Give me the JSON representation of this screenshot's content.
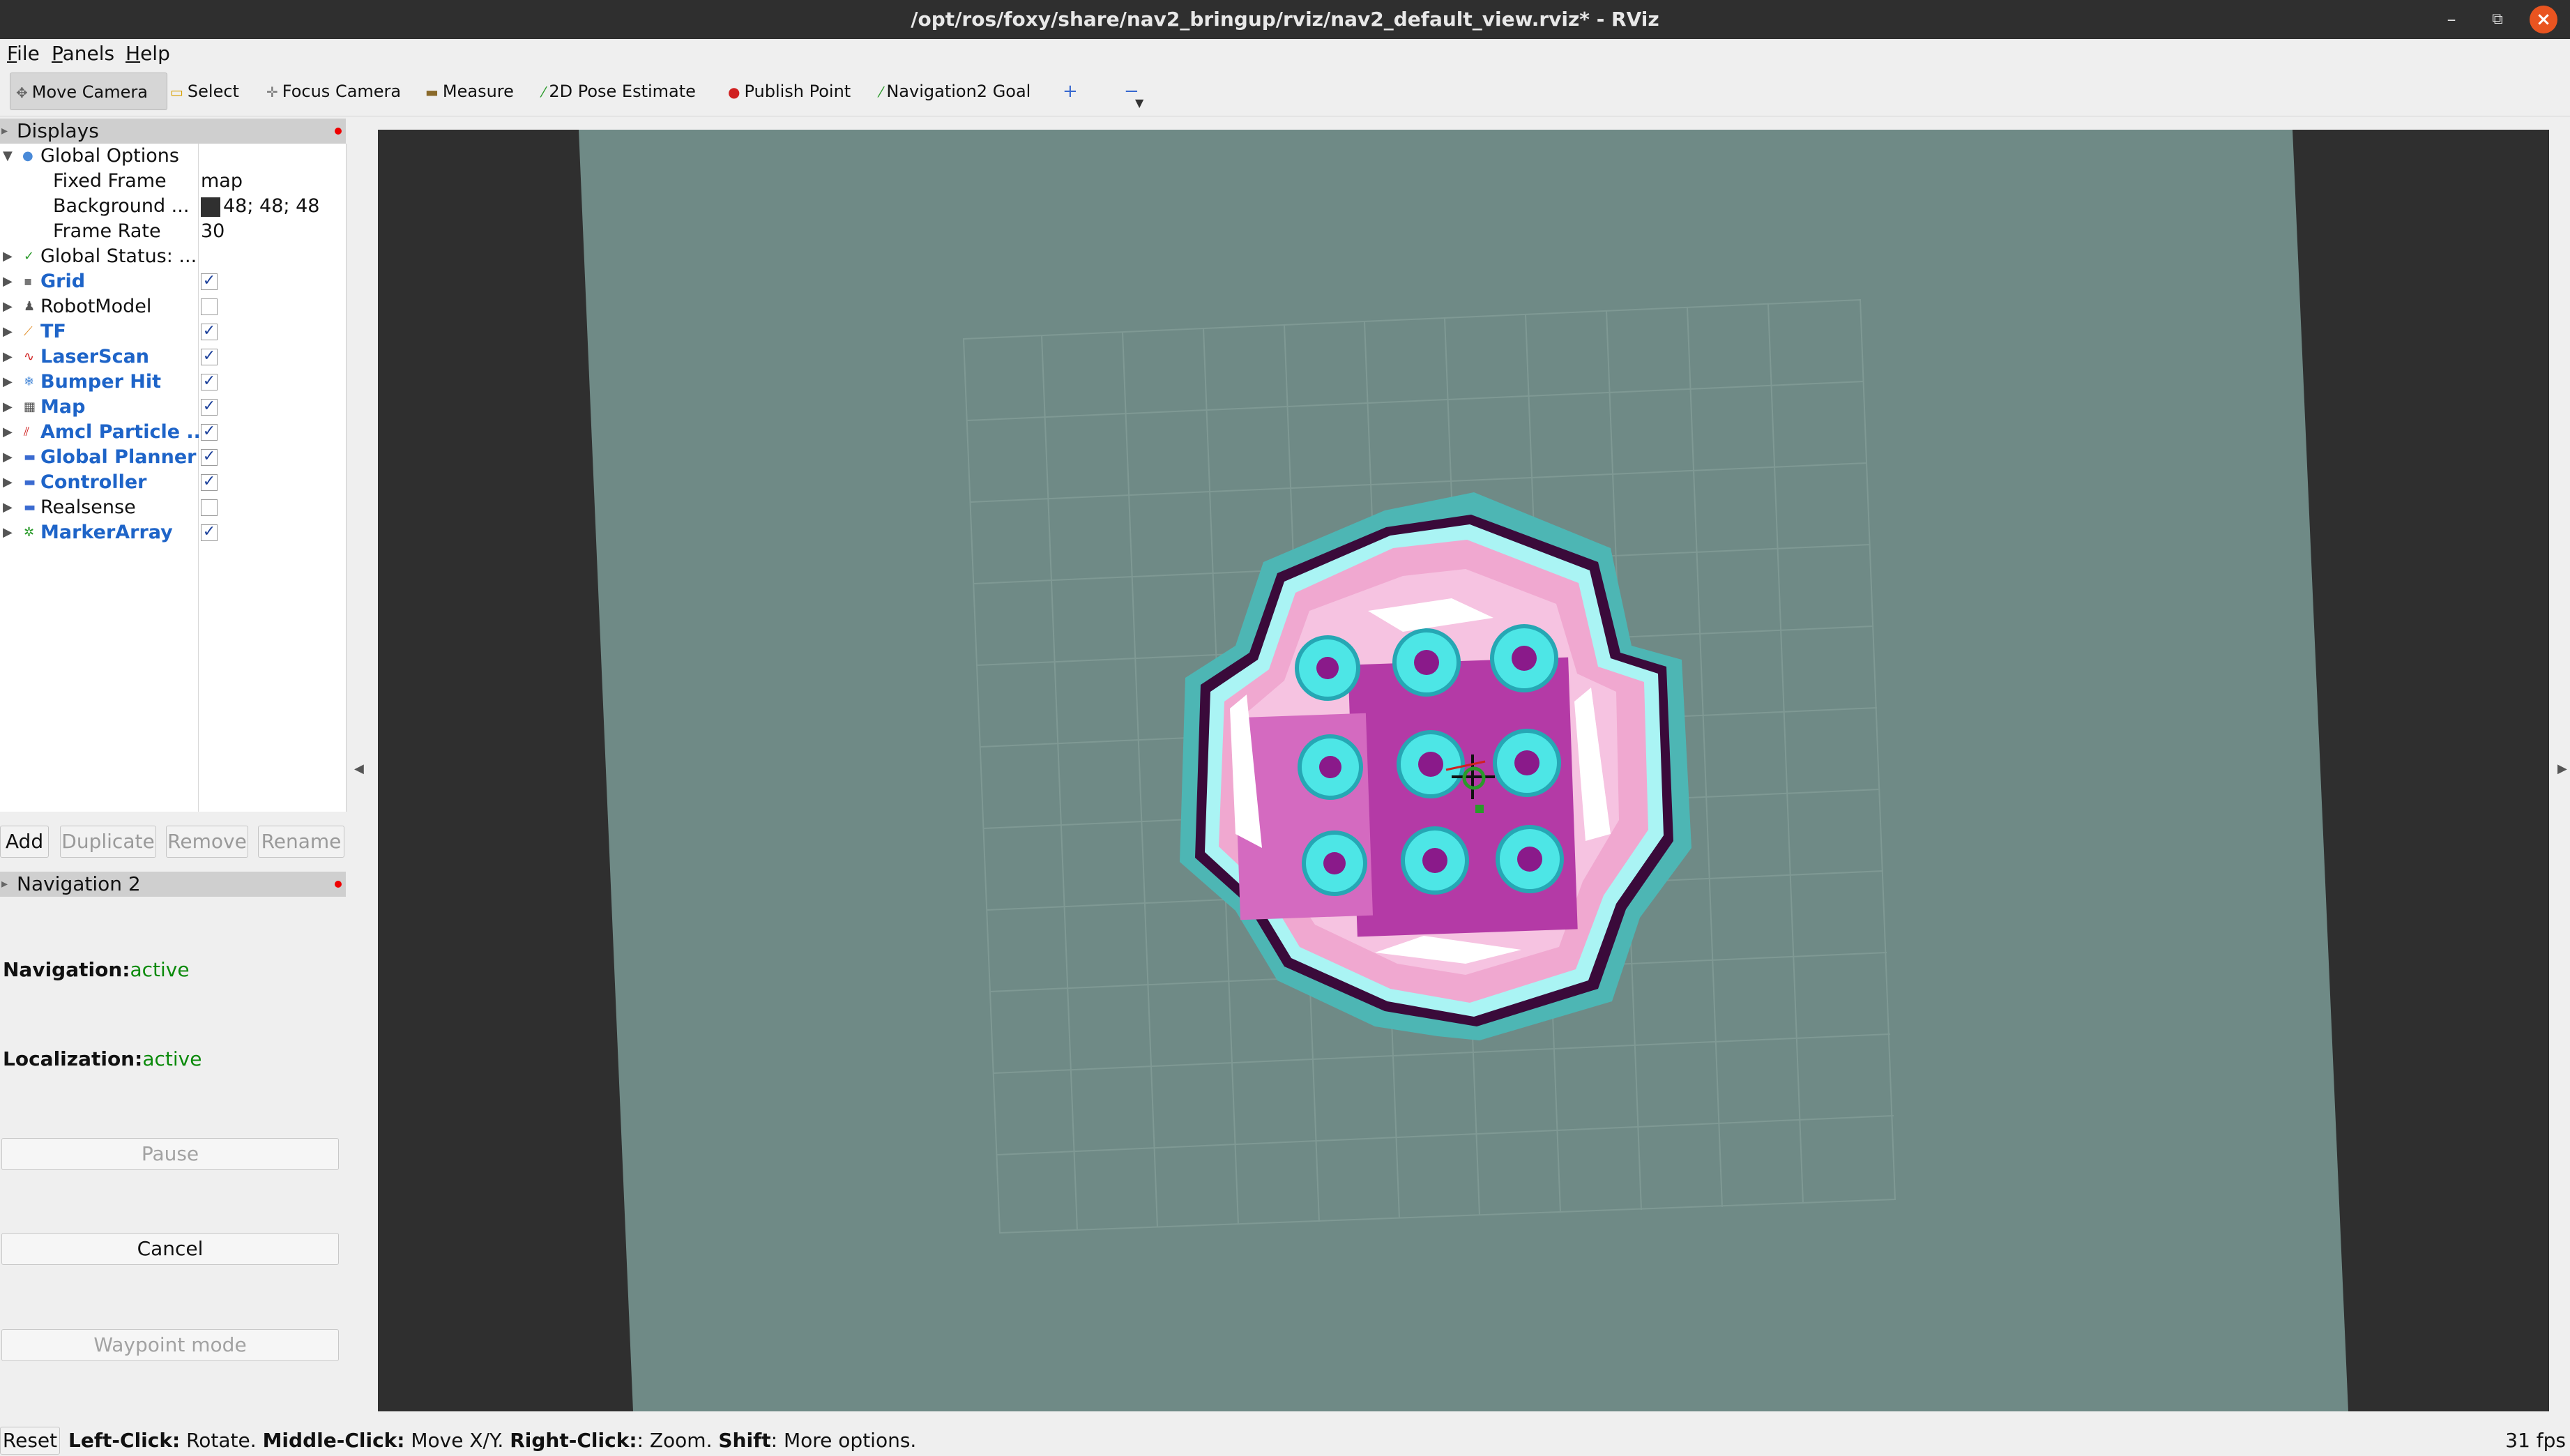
{
  "window": {
    "title": "/opt/ros/foxy/share/nav2_bringup/rviz/nav2_default_view.rviz* - RViz"
  },
  "menu": [
    {
      "key": "F",
      "rest": "ile"
    },
    {
      "key": "P",
      "rest": "anels"
    },
    {
      "key": "H",
      "rest": "elp"
    }
  ],
  "toolbar": {
    "move_camera": "Move Camera",
    "select": "Select",
    "focus_camera": "Focus Camera",
    "measure": "Measure",
    "pose_estimate": "2D Pose Estimate",
    "publish_point": "Publish Point",
    "nav2_goal": "Navigation2 Goal",
    "plus_icon": "+",
    "minus_icon": "−"
  },
  "displays": {
    "title": "Displays",
    "global_options": "Global Options",
    "fixed_frame_label": "Fixed Frame",
    "fixed_frame_value": "map",
    "background_label": "Background ...",
    "background_value": "48; 48; 48",
    "background_color": "#303030",
    "frame_rate_label": "Frame Rate",
    "frame_rate_value": "30",
    "global_status": "Global Status: ...",
    "items": [
      {
        "name": "Grid",
        "checked": true,
        "bold": true
      },
      {
        "name": "RobotModel",
        "checked": false,
        "bold": false
      },
      {
        "name": "TF",
        "checked": true,
        "bold": true
      },
      {
        "name": "LaserScan",
        "checked": true,
        "bold": true
      },
      {
        "name": "Bumper Hit",
        "checked": true,
        "bold": true
      },
      {
        "name": "Map",
        "checked": true,
        "bold": true
      },
      {
        "name": "Amcl Particle ...",
        "checked": true,
        "bold": true
      },
      {
        "name": "Global Planner",
        "checked": true,
        "bold": true
      },
      {
        "name": "Controller",
        "checked": true,
        "bold": true
      },
      {
        "name": "Realsense",
        "checked": false,
        "bold": false
      },
      {
        "name": "MarkerArray",
        "checked": true,
        "bold": true
      }
    ],
    "buttons": {
      "add": "Add",
      "duplicate": "Duplicate",
      "remove": "Remove",
      "rename": "Rename"
    }
  },
  "nav2": {
    "title": "Navigation 2",
    "navigation_label": "Navigation:",
    "navigation_status": "active",
    "localization_label": "Localization:",
    "localization_status": "active",
    "pause": "Pause",
    "cancel": "Cancel",
    "waypoint": "Waypoint mode"
  },
  "statusbar": {
    "reset": "Reset",
    "left_click": "Left-Click:",
    "left_text": " Rotate. ",
    "middle_click": "Middle-Click:",
    "middle_text": " Move X/Y. ",
    "right_click": "Right-Click:",
    "right_text": ": Zoom. ",
    "shift": "Shift",
    "shift_text": ": More options.",
    "fps": "31 fps"
  },
  "colors": {
    "accent": "#1e64c8",
    "active": "#0a8a0a",
    "close": "#e95420",
    "floor": "#6f8a86"
  }
}
